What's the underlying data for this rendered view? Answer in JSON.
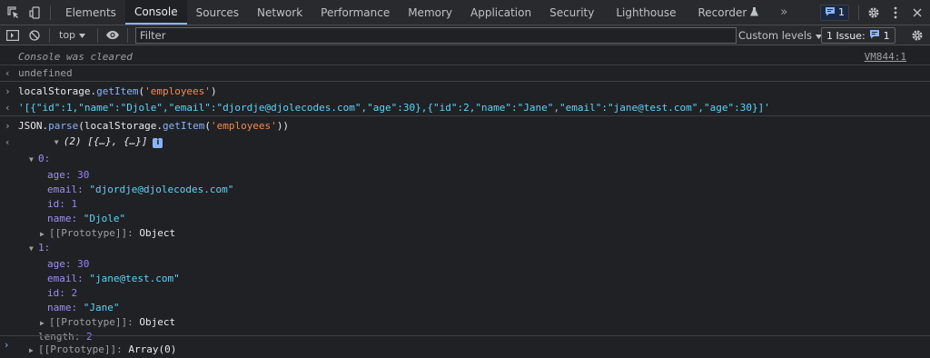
{
  "tabs": {
    "items": [
      "Elements",
      "Console",
      "Sources",
      "Network",
      "Performance",
      "Memory",
      "Application",
      "Security",
      "Lighthouse",
      "Recorder"
    ],
    "active": "Console",
    "more": "»"
  },
  "tab_right": {
    "messages_count": "1"
  },
  "toolbar": {
    "context": "top",
    "filter_placeholder": "Filter",
    "levels": "Custom levels",
    "issues_label": "1 Issue:",
    "issues_count": "1"
  },
  "console": {
    "cleared": "Console was cleared",
    "cleared_source": "VM844:1",
    "undefined": "undefined",
    "cmd1": {
      "obj": "localStorage.",
      "method": "getItem",
      "open": "(",
      "arg": "'employees'",
      "close": ")"
    },
    "result1": "'[{\"id\":1,\"name\":\"Djole\",\"email\":\"djordje@djolecodes.com\",\"age\":30},{\"id\":2,\"name\":\"Jane\",\"email\":\"jane@test.com\",\"age\":30}]'",
    "cmd2": {
      "obj": "JSON.",
      "method": "parse",
      "open": "(localStorage.",
      "method2": "getItem",
      "open2": "(",
      "arg": "'employees'",
      "close": "))"
    },
    "array_summary": "(2) [{…}, {…}]",
    "info_badge": "i",
    "items": [
      {
        "index": "0:",
        "age_key": "age:",
        "age": "30",
        "email_key": "email:",
        "email": "\"djordje@djolecodes.com\"",
        "id_key": "id:",
        "id": "1",
        "name_key": "name:",
        "name": "\"Djole\"",
        "proto_key": "[[Prototype]]:",
        "proto": "Object"
      },
      {
        "index": "1:",
        "age_key": "age:",
        "age": "30",
        "email_key": "email:",
        "email": "\"jane@test.com\"",
        "id_key": "id:",
        "id": "2",
        "name_key": "name:",
        "name": "\"Jane\"",
        "proto_key": "[[Prototype]]:",
        "proto": "Object"
      }
    ],
    "length_key": "length:",
    "length": "2",
    "array_proto_key": "[[Prototype]]:",
    "array_proto": "Array(0)",
    "gutter_in": "›",
    "gutter_out": "‹"
  },
  "colors": {
    "background": "#202124",
    "toolbar": "#292a2d",
    "accent": "#8ab4f8",
    "string": "#f28b54",
    "json_string": "#5cd5fb",
    "key": "#9e8ff6",
    "number": "#9980ff"
  },
  "icons": [
    "inspect-element-icon",
    "device-toolbar-icon",
    "recorder-flask-icon",
    "message-bubble-icon",
    "gear-icon",
    "kebab-menu-icon",
    "close-icon",
    "sidebar-toggle-icon",
    "clear-console-icon",
    "dropdown-arrow-icon",
    "eye-icon",
    "expand-triangle-icon",
    "collapse-triangle-icon",
    "info-icon"
  ]
}
